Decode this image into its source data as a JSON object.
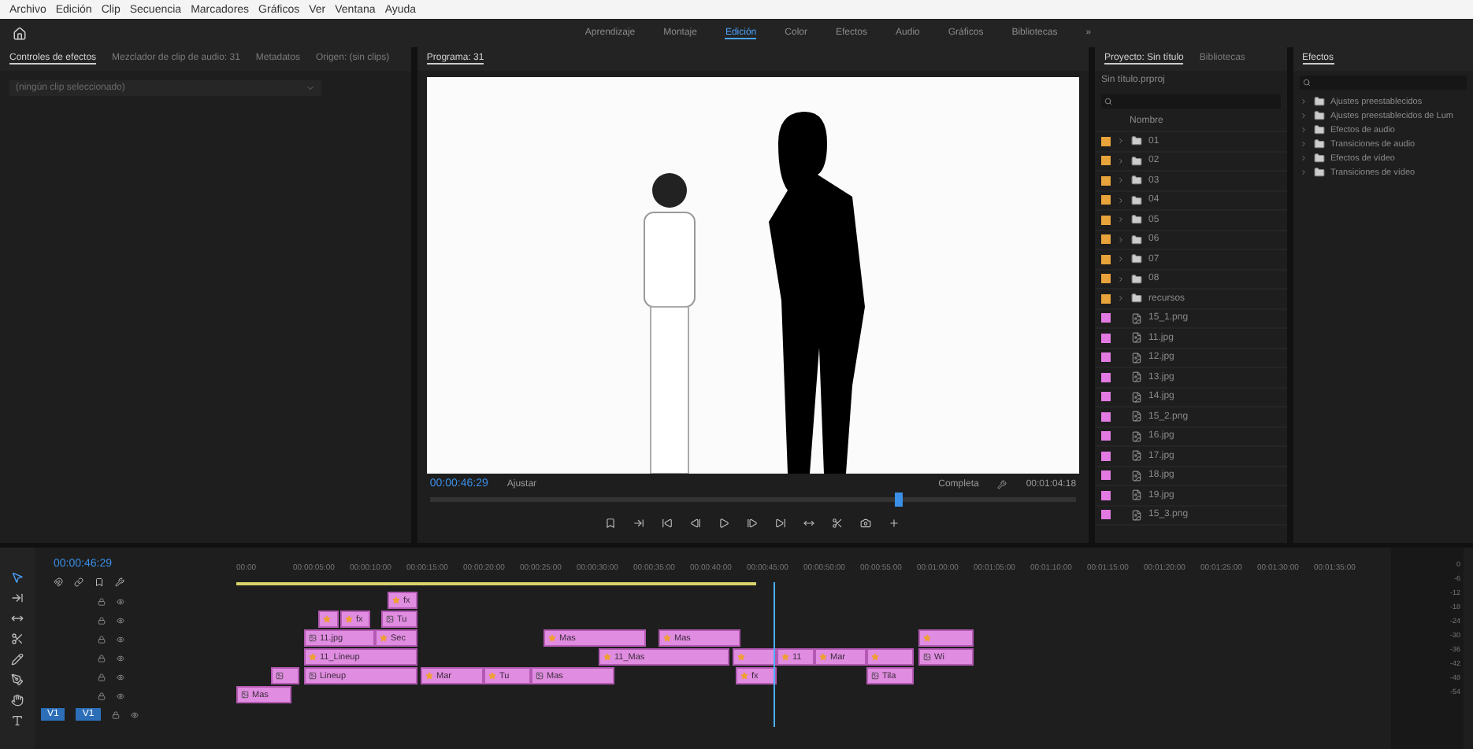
{
  "menu": [
    "Archivo",
    "Edición",
    "Clip",
    "Secuencia",
    "Marcadores",
    "Gráficos",
    "Ver",
    "Ventana",
    "Ayuda"
  ],
  "workspaces": [
    {
      "label": "Aprendizaje",
      "selected": false
    },
    {
      "label": "Montaje",
      "selected": false
    },
    {
      "label": "Edición",
      "selected": true
    },
    {
      "label": "Color",
      "selected": false
    },
    {
      "label": "Efectos",
      "selected": false
    },
    {
      "label": "Audio",
      "selected": false
    },
    {
      "label": "Gráficos",
      "selected": false
    },
    {
      "label": "Bibliotecas",
      "selected": false
    }
  ],
  "workspace_overflow": "»",
  "effect_controls": {
    "tabs": [
      {
        "label": "Controles de efectos",
        "selected": true
      },
      {
        "label": "Mezclador de clip de audio: 31",
        "selected": false
      },
      {
        "label": "Metadatos",
        "selected": false
      },
      {
        "label": "Origen: (sin clips)",
        "selected": false
      }
    ],
    "message": "(ningún clip seleccionado)"
  },
  "program": {
    "title": "Programa: 31",
    "timecode": "00:00:46:29",
    "fit": "Ajustar",
    "quality": "Completa",
    "duration": "00:01:04:18",
    "level": 0.72
  },
  "project": {
    "tabs": [
      {
        "label": "Proyecto: Sin título",
        "selected": true
      },
      {
        "label": "Bibliotecas",
        "selected": false
      }
    ],
    "file": "Sin título.prproj",
    "column": "Nombre",
    "items": [
      {
        "kind": "folder",
        "name": "01",
        "color": "#e8a33a"
      },
      {
        "kind": "folder",
        "name": "02",
        "color": "#e8a33a"
      },
      {
        "kind": "folder",
        "name": "03",
        "color": "#e8a33a"
      },
      {
        "kind": "folder",
        "name": "04",
        "color": "#e8a33a"
      },
      {
        "kind": "folder",
        "name": "05",
        "color": "#e8a33a"
      },
      {
        "kind": "folder",
        "name": "06",
        "color": "#e8a33a"
      },
      {
        "kind": "folder",
        "name": "07",
        "color": "#e8a33a"
      },
      {
        "kind": "folder",
        "name": "08",
        "color": "#e8a33a"
      },
      {
        "kind": "folder",
        "name": "recursos",
        "color": "#e8a33a"
      },
      {
        "kind": "image",
        "name": "15_1.png",
        "color": "#e27ae2"
      },
      {
        "kind": "image",
        "name": "11.jpg",
        "color": "#e27ae2"
      },
      {
        "kind": "image",
        "name": "12.jpg",
        "color": "#e27ae2"
      },
      {
        "kind": "image",
        "name": "13.jpg",
        "color": "#e27ae2"
      },
      {
        "kind": "image",
        "name": "14.jpg",
        "color": "#e27ae2"
      },
      {
        "kind": "image",
        "name": "15_2.png",
        "color": "#e27ae2"
      },
      {
        "kind": "image",
        "name": "16.jpg",
        "color": "#e27ae2"
      },
      {
        "kind": "image",
        "name": "17.jpg",
        "color": "#e27ae2"
      },
      {
        "kind": "image",
        "name": "18.jpg",
        "color": "#e27ae2"
      },
      {
        "kind": "image",
        "name": "19.jpg",
        "color": "#e27ae2"
      },
      {
        "kind": "image",
        "name": "15_3.png",
        "color": "#e27ae2"
      }
    ]
  },
  "effects": {
    "title": "Efectos",
    "items": [
      "Ajustes preestablecidos",
      "Ajustes preestablecidos de Lum",
      "Efectos de audio",
      "Transiciones de audio",
      "Efectos de vídeo",
      "Transiciones de vídeo"
    ]
  },
  "timeline": {
    "timecode": "00:00:46:29",
    "ruler": [
      "00:00",
      "00:00:05:00",
      "00:00:10:00",
      "00:00:15:00",
      "00:00:20:00",
      "00:00:25:00",
      "00:00:30:00",
      "00:00:35:00",
      "00:00:40:00",
      "00:00:45:00",
      "00:00:50:00",
      "00:00:55:00",
      "00:01:00:00",
      "00:01:05:00",
      "00:01:10:00",
      "00:01:15:00",
      "00:01:20:00",
      "00:01:25:00",
      "00:01:30:00",
      "00:01:35:00"
    ],
    "source_patch": "V1",
    "target_track": "V1",
    "clips": [
      {
        "label": "fx",
        "kind": "fx"
      },
      {
        "kind": "fx"
      },
      {
        "label": "fx",
        "kind": "fx"
      },
      {
        "label": "Tu",
        "kind": "image"
      },
      {
        "label": "11.jpg",
        "kind": "image"
      },
      {
        "label": "Sec",
        "kind": "fx"
      },
      {
        "label": "Mas",
        "kind": "fx"
      },
      {
        "label": "Mas",
        "kind": "fx"
      },
      {
        "kind": "fx"
      },
      {
        "label": "11_Lineup",
        "kind": "fx"
      },
      {
        "label": "11_Mas",
        "kind": "fx"
      },
      {
        "kind": "fx"
      },
      {
        "label": "11",
        "kind": "fx"
      },
      {
        "label": "Mar",
        "kind": "fx"
      },
      {
        "kind": "fx"
      },
      {
        "label": "Wi",
        "kind": "image"
      },
      {
        "kind": "image"
      },
      {
        "label": "Lineup",
        "kind": "image"
      },
      {
        "label": "Mar",
        "kind": "fx"
      },
      {
        "label": "Tu",
        "kind": "fx"
      },
      {
        "label": "Mas",
        "kind": "image"
      },
      {
        "label": "fx",
        "kind": "fx"
      },
      {
        "label": "Tila",
        "kind": "image"
      },
      {
        "label": "Mas",
        "kind": "image"
      }
    ],
    "meter_scale": [
      "0",
      "-6",
      "-12",
      "-18",
      "-24",
      "-30",
      "-36",
      "-42",
      "-48",
      "-54"
    ]
  }
}
